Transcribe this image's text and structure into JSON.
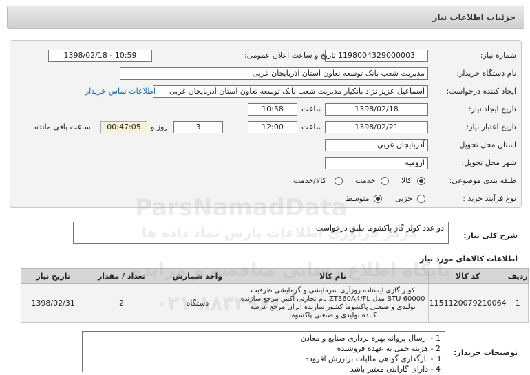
{
  "header": {
    "title": "جزئیات اطلاعات نیاز"
  },
  "form": {
    "need_number_label": "شماره نیاز:",
    "need_number": "1198004329000003",
    "announce_label": "تاریخ و ساعت اعلان عمومی:",
    "announce_value": "1398/02/18 - 10:59",
    "buyer_org_label": "نام دستگاه خریدار:",
    "buyer_org": "مدیریت شعب بانک توسعه تعاون استان آذربایجان غربی",
    "creator_label": "ایجاد کننده درخواست:",
    "creator": "اسماعیل عزیز نژاد بانکیار مدیریت شعب بانک توسعه تعاون استان آذربایجان غربی",
    "contact_link": "اطلاعات تماس خریدار",
    "created_date_label": "تاریخ ایجاد نیاز:",
    "created_date": "1398/02/18",
    "hour_label": "ساعت",
    "created_time": "10:58",
    "validity_label": "تاریخ اعتبار نیاز:",
    "validity_date": "1398/02/21",
    "validity_time": "12:00",
    "days_value": "3",
    "days_label": "روز و",
    "remaining_time": "00:47:05",
    "remaining_label": "ساعت باقی مانده",
    "province_label": "استان محل تحویل:",
    "province": "آذربایجان غربی",
    "city_label": "شهر محل تحویل:",
    "city": "ارومیه",
    "category_label": "طبقه بندی موضوعی:",
    "category_options": [
      "کالا",
      "خدمت",
      "کالا/خدمت"
    ],
    "process_label": "نوع فرآیند خرید :",
    "process_options": [
      "جزیی",
      "متوسط"
    ]
  },
  "summary": {
    "label": "شرح کلی نیاز:",
    "text": "دو عدد کولر گاز پاکشوما طبق درخواست"
  },
  "items": {
    "title": "اطلاعات کالاهای مورد نیاز",
    "headers": [
      "ردیف",
      "کد کالا",
      "نام کالا",
      "واحد شمارش",
      "تعداد / مقدار",
      "تاریخ نیاز"
    ],
    "rows": [
      {
        "row": "1",
        "code": "1151120079210064",
        "name_lines": [
          "کولر گازی ایستاده روزآری سرمایشی و گرمایشی ظرفیت",
          "60000 BTU مدل ZT360A4/FL نام تجارتی آکس مرجع سازنده",
          "تولیدی و صنعتی پاکشوما کشور سازنده ایران مرجع عرضه",
          "کننده تولیدی و صنعتی پاکشوما"
        ],
        "unit": "دستگاه",
        "qty": "2",
        "date": "1398/02/31"
      }
    ]
  },
  "buyer_notes": {
    "label": "توضیحات خریدار:",
    "lines": [
      "1 - ارسال پروانه بهره برداری صنایع و معادن",
      "2 - هزینه حمل به عهده فروشنده",
      "3 - بارگذاری گواهی مالیات برارزش افزوده",
      "4 - دارای گارانتی معتبر باشد"
    ]
  },
  "watermark": {
    "brand": "ParsNamadData",
    "tagline": "مرکز فرآوری اطلاعات پارس نماد داده ها",
    "portal": "پایگاه اطلاع رسانی مناقصه و مزایده",
    "phone": "۰۲۱-۸۸۳۴۹۶۷۰"
  }
}
